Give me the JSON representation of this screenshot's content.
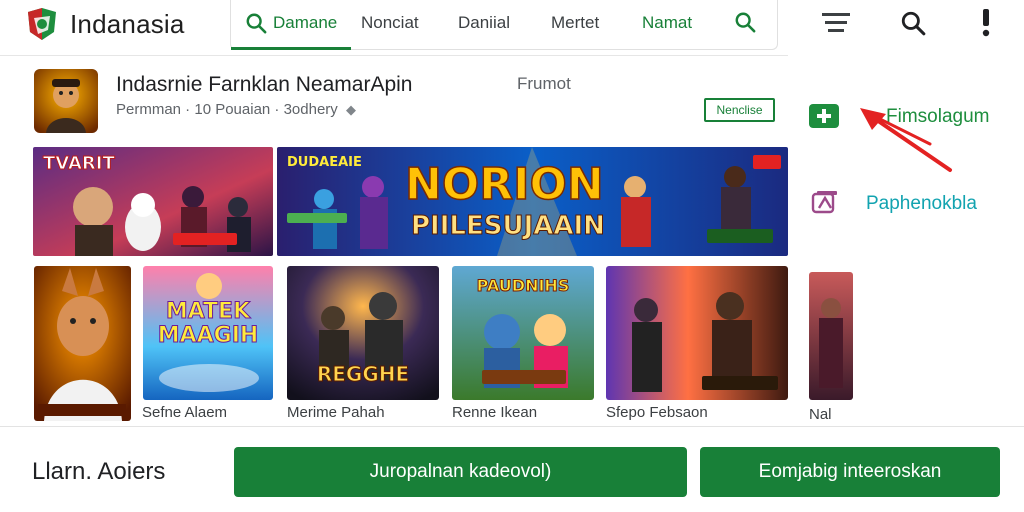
{
  "header": {
    "app_title": "Indanasia",
    "nav": [
      "Damane",
      "Nonciat",
      "Daniial",
      "Mertet",
      "Namat"
    ]
  },
  "featured": {
    "name": "Indasrnie Farnklan NeamarApin",
    "meta": "Permman · 10 Pouaian · 3odhery",
    "label": "Frumot",
    "badge": "Nenclise"
  },
  "banners": [
    {
      "title": "TVARIT"
    },
    {
      "title": "NORION",
      "subtitle": "PIILESUJAAIN",
      "tag": "DUDAEAIE"
    }
  ],
  "thumbnails": [
    {
      "label": "Sefne Alaem",
      "title": ""
    },
    {
      "label": "",
      "title": "MATEK MAAGIH"
    },
    {
      "label": "Merime Pahah",
      "title": "REGGHE"
    },
    {
      "label": "Renne Ikean",
      "title": "PAUDNIHS"
    },
    {
      "label": "Sfepo Febsaon",
      "title": ""
    },
    {
      "label": "Nal",
      "title": ""
    }
  ],
  "sidebar": {
    "items": [
      {
        "label": "Fimsolagum",
        "color": "#1e8e3e"
      },
      {
        "label": "Paphenokbla",
        "color": "#12a3b0"
      }
    ]
  },
  "footer": {
    "text": "Llarn. Aoiers",
    "buttons": [
      "Juropalnan kadeovol)",
      "Eomjabig inteeroskan"
    ]
  },
  "colors": {
    "accent": "#188038",
    "teal": "#12a3b0",
    "arrow": "#e32222"
  },
  "icons": [
    "logo-icon",
    "search-icon",
    "menu-icon",
    "more-vert-icon",
    "add-icon",
    "library-icon"
  ]
}
